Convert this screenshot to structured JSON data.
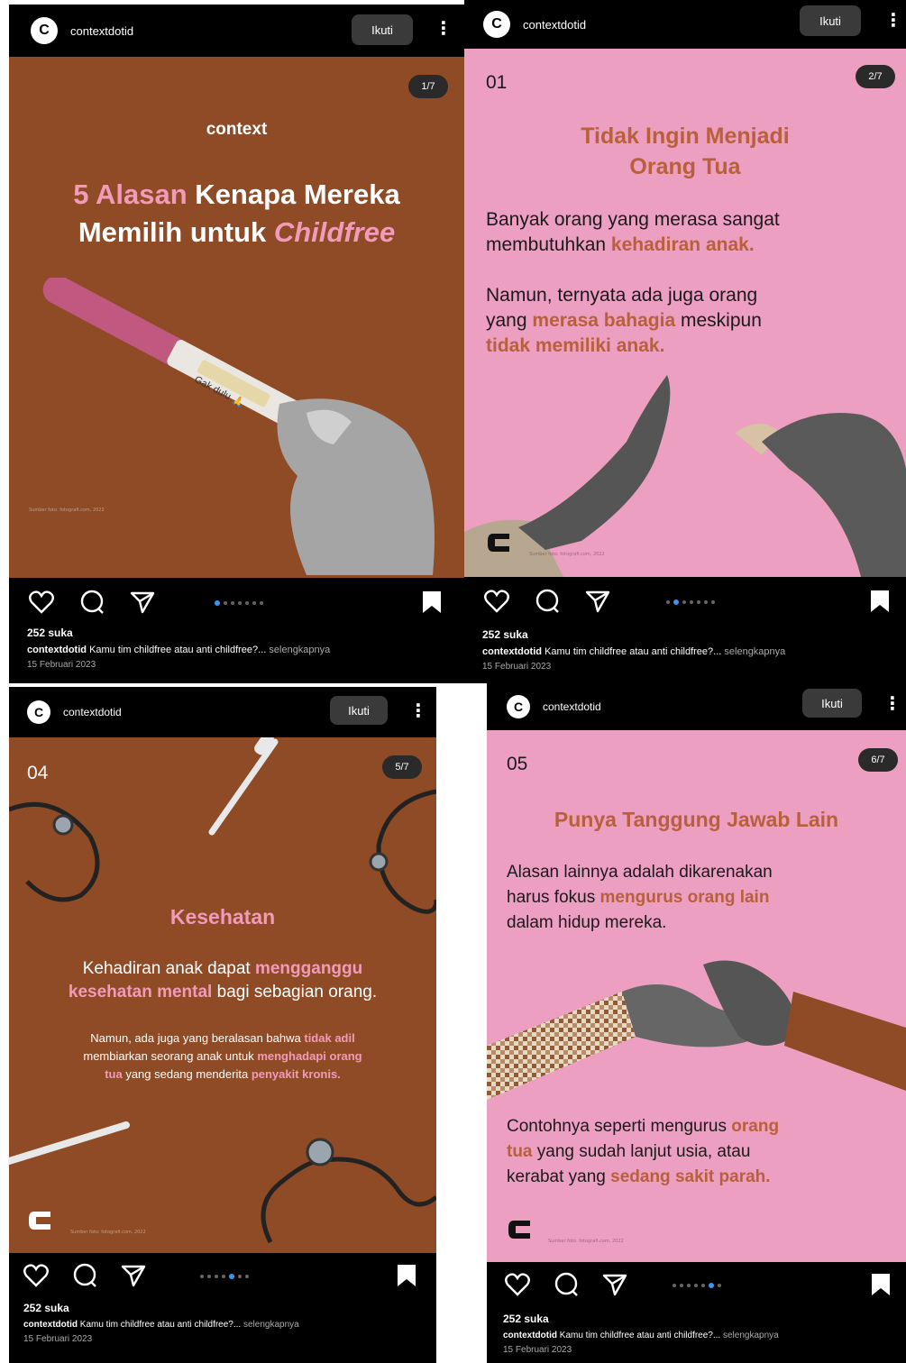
{
  "common": {
    "username": "contextdotid",
    "follow_label": "Ikuti",
    "likes": "252 suka",
    "caption_text": "Kamu tim childfree atau anti childfree?...",
    "more_label": "selengkapnya",
    "date": "15 Februari 2023",
    "logo_letter": "C",
    "credit": "Sumber foto: fotografi.com, 2022"
  },
  "post1": {
    "counter": "1/7",
    "brand": "context",
    "title_a": "5 Alasan",
    "title_b": "Kenapa Mereka",
    "title_c": "Memilih untuk",
    "title_d": "Childfree",
    "test_label": "Gak dulu 🙏",
    "active_dot": 0
  },
  "post2": {
    "counter": "2/7",
    "number": "01",
    "title_1": "Tidak Ingin Menjadi",
    "title_2": "Orang Tua",
    "p1_a": "Banyak orang yang merasa sangat",
    "p1_b": "membutuhkan",
    "p1_c": "kehadiran anak.",
    "p2_a": "Namun, ternyata ada juga orang",
    "p2_b": "yang",
    "p2_c": "merasa bahagia",
    "p2_d": "meskipun",
    "p2_e": "tidak memiliki anak.",
    "active_dot": 1
  },
  "post3": {
    "counter": "5/7",
    "number": "04",
    "title": "Kesehatan",
    "p1_a": "Kehadiran anak dapat",
    "p1_b": "mengganggu",
    "p1_c": "kesehatan mental",
    "p1_d": "bagi sebagian orang.",
    "p2_a": "Namun, ada juga yang beralasan bahwa",
    "p2_b": "tidak adil",
    "p2_c": "membiarkan seorang anak untuk",
    "p2_d": "menghadapi orang",
    "p2_e": "tua",
    "p2_f": "yang sedang menderita",
    "p2_g": "penyakit kronis.",
    "active_dot": 4
  },
  "post4": {
    "counter": "6/7",
    "number": "05",
    "title": "Punya Tanggung Jawab Lain",
    "p1_a": "Alasan lainnya adalah dikarenakan",
    "p1_b": "harus fokus",
    "p1_c": "mengurus orang lain",
    "p1_d": "dalam hidup mereka.",
    "p2_a": "Contohnya seperti mengurus",
    "p2_b": "orang",
    "p2_c": "tua",
    "p2_d": "yang sudah lanjut usia, atau",
    "p2_e": "kerabat yang",
    "p2_f": "sedang sakit parah.",
    "active_dot": 5
  },
  "colors": {
    "brown_bg": "#8f4a26",
    "pink_bg": "#ec9fc1",
    "accent_pink": "#f29ab9",
    "accent_orange": "#b8603a",
    "dot_active": "#3897f0"
  },
  "icons": [
    "heart-icon",
    "comment-icon",
    "share-icon",
    "bookmark-icon",
    "kebab-icon",
    "context-logo-icon"
  ]
}
